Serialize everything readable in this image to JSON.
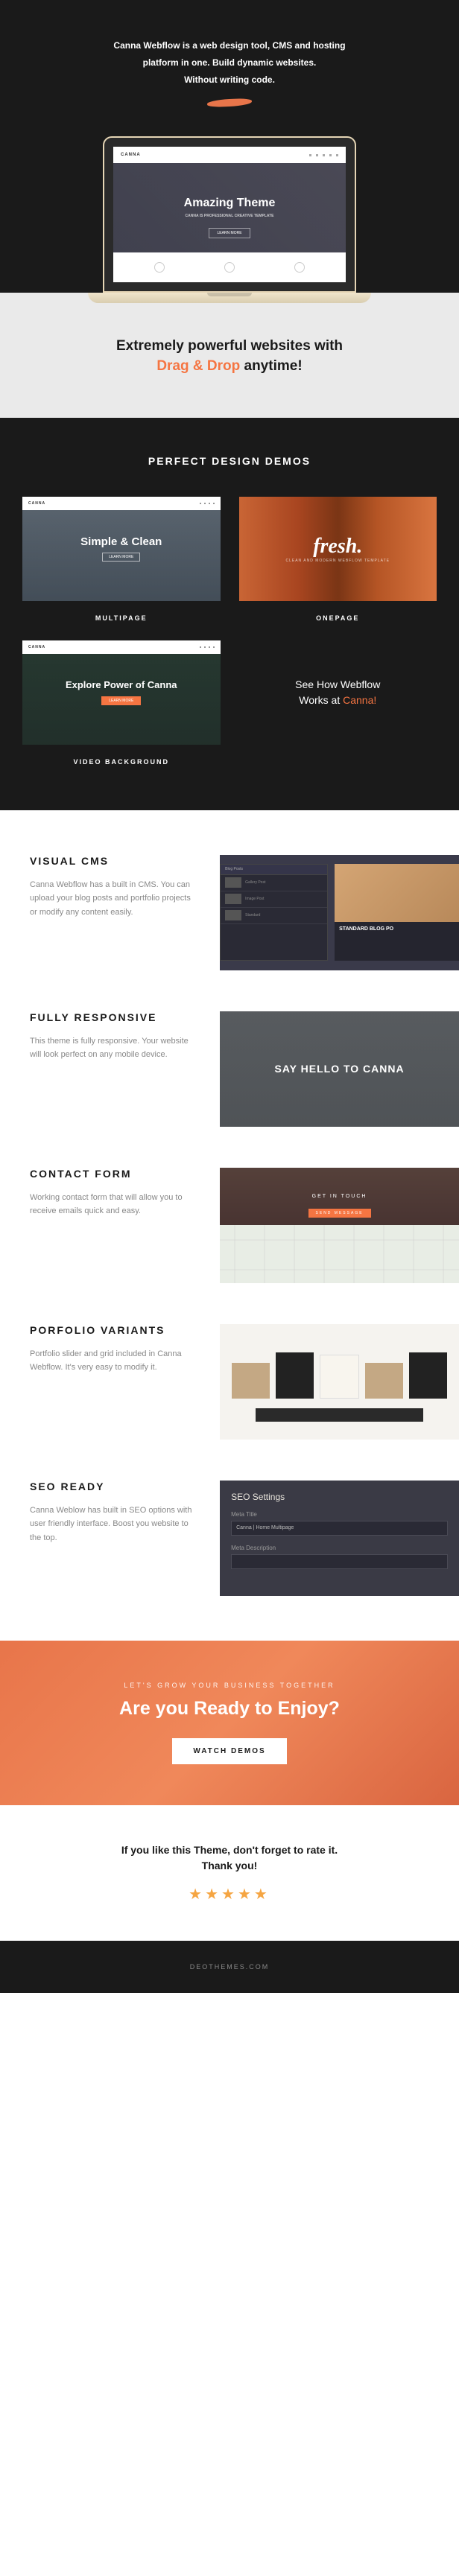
{
  "hero": {
    "line1": "Canna Webflow is a web design tool, CMS and hosting",
    "line2": "platform in one. Build dynamic websites.",
    "line3": "Without writing code."
  },
  "laptop": {
    "logo": "CANNA",
    "title": "Amazing Theme",
    "subtitle": "CANNA IS PROFESSIONAL CREATIVE TEMPLATE",
    "button": "LEARN MORE"
  },
  "powerful": {
    "line1": "Extremely powerful websites with",
    "highlight": "Drag & Drop",
    "line2_rest": " anytime!"
  },
  "demos": {
    "heading": "PERFECT DESIGN DEMOS",
    "items": [
      {
        "logo": "CANNA",
        "title": "Simple & Clean",
        "btn": "LEARN MORE",
        "label": "MULTIPAGE"
      },
      {
        "title": "fresh.",
        "subtitle": "CLEAN AND MODERN WEBFLOW TEMPLATE",
        "label": "ONEPAGE"
      },
      {
        "logo": "CANNA",
        "title": "Explore Power of Canna",
        "btn": "LEARN MORE",
        "label": "VIDEO BACKGROUND"
      }
    ],
    "webflow_text1": "See How Webflow",
    "webflow_text2": "Works at ",
    "webflow_highlight": "Canna!"
  },
  "features": [
    {
      "title": "VISUAL CMS",
      "desc": "Canna Webflow has a built in CMS. You can upload your blog posts and portfolio projects or modify any content easily."
    },
    {
      "title": "FULLY RESPONSIVE",
      "desc": "This theme is fully responsive. Your website will look perfect on any mobile device."
    },
    {
      "title": "CONTACT FORM",
      "desc": "Working contact form that will allow you to receive emails quick and easy."
    },
    {
      "title": "PORFOLIO VARIANTS",
      "desc": "Portfolio slider and grid included in Canna Webflow. It's very easy to modify it."
    },
    {
      "title": "SEO READY",
      "desc": "Canna Weblow has built in SEO options with user friendly interface. Boost you website to the top."
    }
  ],
  "cms": {
    "panel": "Blog Posts",
    "right_title": "STANDARD BLOG PO"
  },
  "responsive": {
    "text": "SAY HELLO TO CANNA"
  },
  "contact": {
    "text": "GET IN TOUCH",
    "btn": "SEND MESSAGE"
  },
  "seo": {
    "heading": "SEO Settings",
    "label1": "Meta Title",
    "value1": "Canna | Home Multipage",
    "label2": "Meta Description"
  },
  "cta": {
    "small": "LET'S GROW YOUR BUSINESS TOGETHER",
    "heading": "Are you Ready to Enjoy?",
    "button": "WATCH DEMOS"
  },
  "rate": {
    "line1": "If you like this Theme, don't forget to rate it.",
    "line2": "Thank you!",
    "stars": "★★★★★"
  },
  "footer": "DEOTHEMES.COM"
}
